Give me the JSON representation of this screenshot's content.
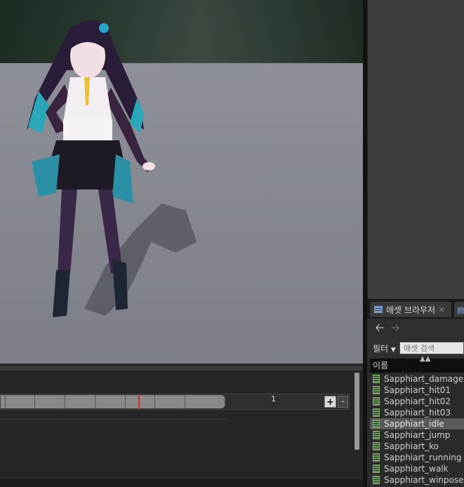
{
  "asset_browser": {
    "tab_label": "애셋 브라우저",
    "tab_close": "×",
    "filter_label": "필터",
    "search_placeholder": "애셋 검색",
    "column_name": "이름",
    "assets": [
      {
        "name": "Sapphiart_damage",
        "selected": false
      },
      {
        "name": "Sapphiart_hit01",
        "selected": false
      },
      {
        "name": "Sapphiart_hit02",
        "selected": false
      },
      {
        "name": "Sapphiart_hit03",
        "selected": false
      },
      {
        "name": "Sapphiart_idle",
        "selected": true
      },
      {
        "name": "Sapphiart_jump",
        "selected": false
      },
      {
        "name": "Sapphiart_ko",
        "selected": false
      },
      {
        "name": "Sapphiart_running",
        "selected": false
      },
      {
        "name": "Sapphiart_walk",
        "selected": false
      },
      {
        "name": "Sapphiart_winpose",
        "selected": false
      }
    ]
  },
  "timeline": {
    "frame_label": "1",
    "plus_label": "+",
    "minus_label": "-"
  },
  "icons": {
    "back": "arrow-left-icon",
    "forward": "arrow-right-icon",
    "tab": "content-browser-icon",
    "filter_dropdown": "chevron-down-icon"
  }
}
